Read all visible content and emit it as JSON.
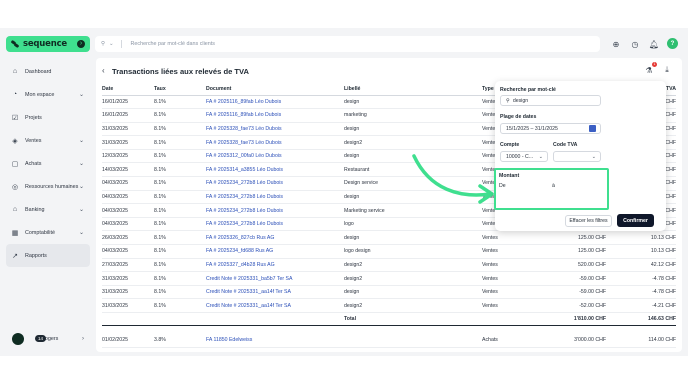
{
  "brand": {
    "name": "sequence"
  },
  "search": {
    "placeholder": "Recherche par mot-clé dans clients"
  },
  "sidebar": {
    "items": [
      {
        "label": "Dashboard",
        "icon": "house-icon",
        "chevron": false
      },
      {
        "label": "Mon espace",
        "icon": "user-icon",
        "chevron": true
      },
      {
        "label": "Projets",
        "icon": "checkbox-icon",
        "chevron": false
      },
      {
        "label": "Ventes",
        "icon": "tag-icon",
        "chevron": true
      },
      {
        "label": "Achats",
        "icon": "bag-icon",
        "chevron": true
      },
      {
        "label": "Ressources humaines",
        "icon": "people-icon",
        "chevron": true
      },
      {
        "label": "Banking",
        "icon": "bank-icon",
        "chevron": true
      },
      {
        "label": "Comptabilité",
        "icon": "calculator-icon",
        "chevron": true
      },
      {
        "label": "Rapports",
        "icon": "chart-icon",
        "chevron": false,
        "active": true
      }
    ],
    "footer": {
      "badge": "14",
      "label": "Rogers"
    }
  },
  "page": {
    "title": "Transactions liées aux relevés de TVA",
    "notification_count": "1"
  },
  "table": {
    "headers": {
      "date": "Date",
      "taux": "Taux",
      "document": "Document",
      "libelle": "Libellé",
      "type": "Type",
      "montant": "",
      "tva": "TVA"
    },
    "rows": [
      {
        "date": "16/01/2025",
        "taux": "8.1%",
        "document": "FA # 2025116_89fab Léo Dubois",
        "libelle": "design",
        "type": "Vente",
        "montant": "",
        "tva": "1 CHF"
      },
      {
        "date": "16/01/2025",
        "taux": "8.1%",
        "document": "FA # 2025116_89fab Léo Dubois",
        "libelle": "marketing",
        "type": "Vente",
        "montant": "",
        "tva": "1 CHF"
      },
      {
        "date": "31/03/2025",
        "taux": "8.1%",
        "document": "FA # 2025328_fae73 Léo Dubois",
        "libelle": "design",
        "type": "Vente",
        "montant": "",
        "tva": "2 CHF"
      },
      {
        "date": "31/03/2025",
        "taux": "8.1%",
        "document": "FA # 2025328_fae73 Léo Dubois",
        "libelle": "design2",
        "type": "Vente",
        "montant": "",
        "tva": "6 CHF"
      },
      {
        "date": "12/03/2025",
        "taux": "8.1%",
        "document": "FA # 2025312_00fa0 Léo Dubois",
        "libelle": "design",
        "type": "Vente",
        "montant": "",
        "tva": "4 CHF"
      },
      {
        "date": "14/03/2025",
        "taux": "8.1%",
        "document": "FA # 2025314_a3855 Léo Dubois",
        "libelle": "Restaurant",
        "type": "Vente",
        "montant": "",
        "tva": "9 CHF"
      },
      {
        "date": "04/03/2025",
        "taux": "8.1%",
        "document": "FA # 2025234_272b8 Léo Dubois",
        "libelle": "Design service",
        "type": "Vente",
        "montant": "",
        "tva": "8 CHF"
      },
      {
        "date": "04/03/2025",
        "taux": "8.1%",
        "document": "FA # 2025234_272b8 Léo Dubois",
        "libelle": "design",
        "type": "Vente",
        "montant": "",
        "tva": "1 CHF"
      },
      {
        "date": "04/03/2025",
        "taux": "8.1%",
        "document": "FA # 2025234_272b8 Léo Dubois",
        "libelle": "Marketing service",
        "type": "Vente",
        "montant": "",
        "tva": "2 CHF"
      },
      {
        "date": "04/03/2025",
        "taux": "8.1%",
        "document": "FA # 2025234_272b8 Léo Dubois",
        "libelle": "logo",
        "type": "Vente",
        "montant": "",
        "tva": "2 CHF"
      },
      {
        "date": "26/03/2025",
        "taux": "8.1%",
        "document": "FA # 2025326_827cb Rus AG",
        "libelle": "design",
        "type": "Ventes",
        "montant": "125.00 CHF",
        "tva": "10.13 CHF"
      },
      {
        "date": "04/03/2025",
        "taux": "8.1%",
        "document": "FA # 2025234_fd688 Rus AG",
        "libelle": "logo design",
        "type": "Ventes",
        "montant": "125.00 CHF",
        "tva": "10.13 CHF"
      },
      {
        "date": "27/03/2025",
        "taux": "8.1%",
        "document": "FA # 2025327_d4b28 Rus AG",
        "libelle": "design2",
        "type": "Ventes",
        "montant": "520.00 CHF",
        "tva": "42.12 CHF"
      },
      {
        "date": "31/03/2025",
        "taux": "8.1%",
        "document": "Credit Note # 2025331_ba5b7 Ter SA",
        "libelle": "design2",
        "type": "Ventes",
        "montant": "-59.00 CHF",
        "tva": "-4.78 CHF"
      },
      {
        "date": "31/03/2025",
        "taux": "8.1%",
        "document": "Credit Note # 2025331_aa14f Ter SA",
        "libelle": "design",
        "type": "Ventes",
        "montant": "-59.00 CHF",
        "tva": "-4.78 CHF"
      },
      {
        "date": "31/03/2025",
        "taux": "8.1%",
        "document": "Credit Note # 2025331_aa14f Ter SA",
        "libelle": "design2",
        "type": "Ventes",
        "montant": "-52.00 CHF",
        "tva": "-4.21 CHF"
      }
    ],
    "total": {
      "label": "Total",
      "montant": "1'810.00 CHF",
      "tva": "146.63 CHF"
    },
    "extra_row": {
      "date": "01/02/2025",
      "taux": "3.8%",
      "document": "FA 11850 Edelweiss",
      "libelle": "",
      "type": "Achats",
      "montant": "3'000.00 CHF",
      "tva": "114.00 CHF"
    }
  },
  "filter": {
    "keyword_label": "Recherche par mot-clé",
    "keyword_value": "design",
    "date_label": "Plage de dates",
    "date_value": "15/1/2025 – 31/1/2025",
    "compte_label": "Compte",
    "compte_value": "10000 - C...",
    "code_label": "Code TVA",
    "code_value": "",
    "montant_label": "Montant",
    "de_label": "De",
    "a_label": "à",
    "clear_label": "Effacer les filtres",
    "confirm_label": "Confirmer"
  },
  "colors": {
    "brand_green": "#3fdf8f",
    "link_blue": "#2b4fb8",
    "dark": "#0f172a"
  }
}
